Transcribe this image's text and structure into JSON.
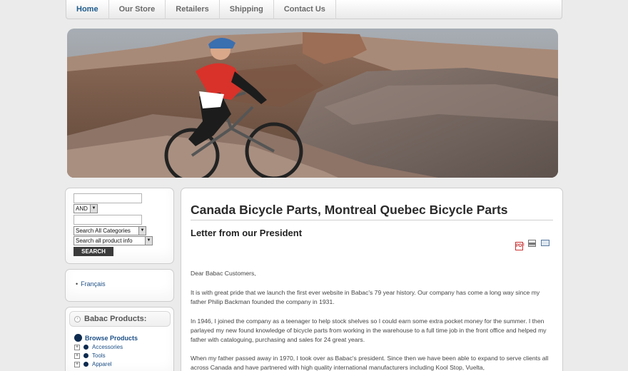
{
  "nav": {
    "items": [
      "Home",
      "Our Store",
      "Retailers",
      "Shipping",
      "Contact Us"
    ]
  },
  "hero": {
    "description_icon": "banner-image"
  },
  "search": {
    "mode_select": "AND",
    "category_select": "Search All Categories",
    "scope_select": "Search all product info",
    "button_label": "SEARCH"
  },
  "language": {
    "link": "Français"
  },
  "products": {
    "header": "Babac Products:",
    "browse": "Browse Products",
    "categories": [
      "Accessories",
      "Tools",
      "Apparel"
    ]
  },
  "content": {
    "title": "Canada Bicycle Parts, Montreal Quebec Bicycle Parts",
    "letter_title": "Letter from our President",
    "paragraphs": [
      "Dear Babac Customers,",
      "It is with great pride that we launch the first ever website in Babac's 79 year history. Our company has come a long way since my father Philip Backman founded the company in 1931.",
      "In 1946, I joined the company as a teenager to help stock shelves so I could earn some extra pocket money for the summer. I then parlayed my new found knowledge of bicycle parts from working in the warehouse to a full time job in the front office and helped my father with cataloguing, purchasing and sales for 24 great years.",
      "When my father passed away in 1970, I took over as Babac's  president. Since then we have been able to expand to serve clients all across Canada and have partnered with high quality international manufacturers including Kool Stop, Vuelta,"
    ]
  },
  "colors": {
    "accent": "#1d5b8c",
    "link": "#1d4f86",
    "background": "#ebebeb"
  }
}
